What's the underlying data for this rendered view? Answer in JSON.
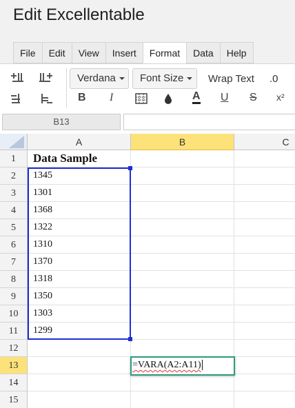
{
  "app": {
    "title": "Edit Excellentable"
  },
  "menu": {
    "tabs": [
      "File",
      "Edit",
      "View",
      "Insert",
      "Format",
      "Data",
      "Help"
    ],
    "active": "Format"
  },
  "toolbar": {
    "font_family": "Verdana",
    "font_size": "Font Size",
    "wrap_text": "Wrap Text",
    "decimal": ".0",
    "bold": "B",
    "italic": "I",
    "font_color": "A",
    "underline": "U",
    "strikethrough": "S",
    "superscript": "x²"
  },
  "namebox": {
    "value": "B13"
  },
  "formula_bar": {
    "value": ""
  },
  "grid": {
    "columns": [
      "A",
      "B",
      "C"
    ],
    "selected_column": "B",
    "rows": [
      "1",
      "2",
      "3",
      "4",
      "5",
      "6",
      "7",
      "8",
      "9",
      "10",
      "11",
      "12",
      "13",
      "14",
      "15"
    ],
    "selected_row": "13",
    "column_a": [
      "Data Sample",
      "1345",
      "1301",
      "1368",
      "1322",
      "1310",
      "1370",
      "1318",
      "1350",
      "1303",
      "1299",
      "",
      "",
      "",
      ""
    ],
    "selected_range": "A2:A11",
    "active_cell": {
      "ref": "B13",
      "value": "=VARA(A2:A11)"
    }
  }
}
